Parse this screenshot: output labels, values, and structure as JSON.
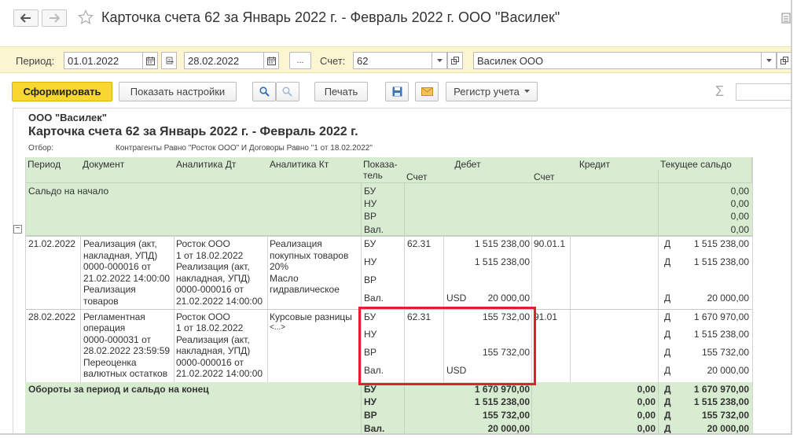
{
  "window": {
    "title": "Карточка счета 62 за Январь 2022 г. - Февраль 2022 г. ООО \"Василек\""
  },
  "filter": {
    "period_label": "Период:",
    "date_from": "01.01.2022",
    "dash": "–",
    "date_to": "28.02.2022",
    "dots": "...",
    "account_label": "Счет:",
    "account": "62",
    "organization": "Василек ООО"
  },
  "toolbar": {
    "generate": "Сформировать",
    "show_settings": "Показать настройки",
    "print": "Печать",
    "register": "Регистр учета",
    "sigma": "Σ"
  },
  "report": {
    "org": "ООО \"Василек\"",
    "title": "Карточка счета 62 за Январь 2022 г. - Февраль 2022 г.",
    "filter_label": "Отбор:",
    "filter_value": "Контрагенты Равно \"Росток ООО\" И Договоры Равно \"1 от 18.02.2022\"",
    "headers": {
      "period": "Период",
      "document": "Документ",
      "analytics_dt": "Аналитика Дт",
      "analytics_kt": "Аналитика Кт",
      "indicator_1": "Показа-",
      "indicator_2": "тель",
      "debit": "Дебет",
      "credit": "Кредит",
      "balance": "Текущее сальдо",
      "account_dt": "Счет",
      "account_kt": "Счет"
    },
    "opening": {
      "label": "Сальдо на начало",
      "indicators": [
        "БУ",
        "НУ",
        "ВР",
        "Вал."
      ],
      "balances": [
        "0,00",
        "0,00",
        "0,00",
        "0,00"
      ]
    },
    "rows": [
      {
        "period": "21.02.2022",
        "document": [
          "Реализация (акт,",
          "накладная, УПД)",
          "0000-000016 от",
          "21.02.2022 14:00:00",
          "Реализация",
          "товаров"
        ],
        "analytics_dt": [
          "Росток ООО",
          "1 от 18.02.2022",
          "Реализация (акт,",
          "накладная, УПД)",
          "0000-000016 от",
          "21.02.2022 14:00:00"
        ],
        "analytics_kt": [
          "Реализация",
          "покупных товаров",
          "20%",
          "Масло",
          "гидравлическое"
        ],
        "indicators": [
          "БУ",
          "НУ",
          "ВР",
          "Вал."
        ],
        "debit_account": "62.31",
        "debit": [
          "1 515 238,00",
          "1 515 238,00",
          "",
          "20 000,00"
        ],
        "currency": "USD",
        "credit_account": "90.01.1",
        "balance_sign": [
          "Д",
          "Д",
          "",
          "Д"
        ],
        "balance": [
          "1 515 238,00",
          "1 515 238,00",
          "",
          "20 000,00"
        ]
      },
      {
        "period": "28.02.2022",
        "document": [
          "Регламентная",
          "операция",
          "0000-000031 от",
          "28.02.2022 23:59:59",
          "Переоценка",
          "валютных остатков"
        ],
        "analytics_dt": [
          "Росток ООО",
          "1 от 18.02.2022",
          "Реализация (акт,",
          "накладная, УПД)",
          "0000-000016 от",
          "21.02.2022 14:00:00"
        ],
        "analytics_kt": [
          "Курсовые разницы",
          "<...>"
        ],
        "indicators": [
          "БУ",
          "НУ",
          "ВР",
          "Вал."
        ],
        "debit_account": "62.31",
        "debit": [
          "155 732,00",
          "",
          "155 732,00",
          ""
        ],
        "currency": "USD",
        "credit_account": "91.01",
        "balance_sign": [
          "Д",
          "Д",
          "Д",
          "Д"
        ],
        "balance": [
          "1 670 970,00",
          "1 515 238,00",
          "155 732,00",
          "20 000,00"
        ]
      }
    ],
    "totals": {
      "label": "Обороты за период и сальдо на конец",
      "indicators": [
        "БУ",
        "НУ",
        "ВР",
        "Вал."
      ],
      "debit": [
        "1 670 970,00",
        "1 515 238,00",
        "155 732,00",
        "20 000,00"
      ],
      "credit": [
        "0,00",
        "0,00",
        "0,00",
        "0,00"
      ],
      "balance_sign": [
        "Д",
        "Д",
        "Д",
        "Д"
      ],
      "balance": [
        "1 670 970,00",
        "1 515 238,00",
        "155 732,00",
        "20 000,00"
      ]
    }
  }
}
